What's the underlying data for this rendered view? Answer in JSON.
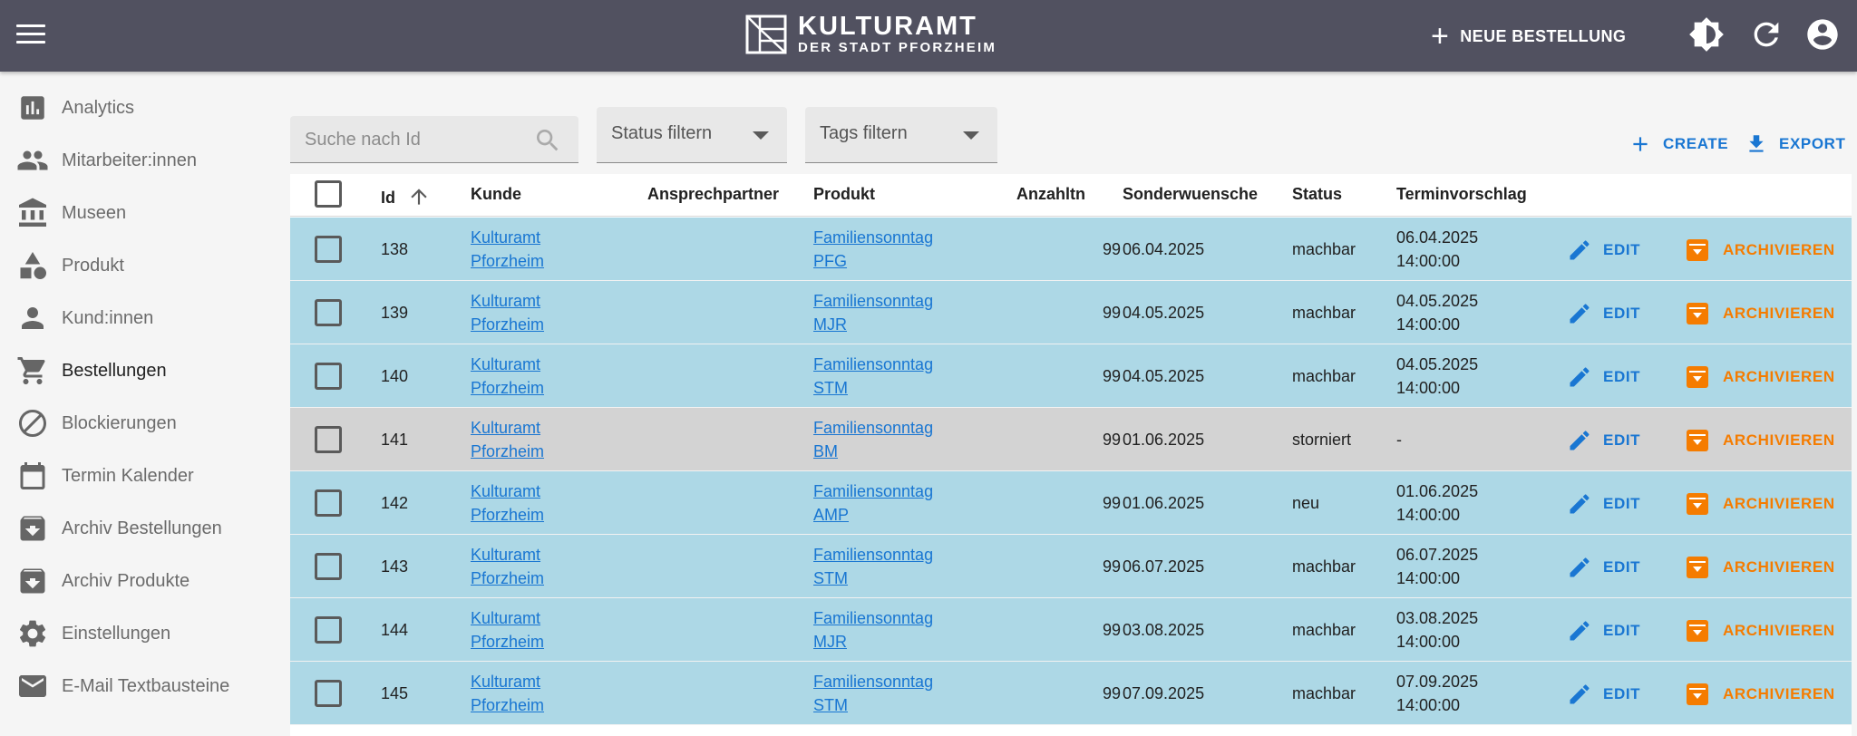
{
  "brand": {
    "name": "KULTURAMT",
    "subtitle": "DER STADT PFORZHEIM"
  },
  "appbar": {
    "new_order_label": "NEUE BESTELLUNG",
    "icons": [
      "menu-icon",
      "brightness-icon",
      "refresh-icon",
      "account-icon"
    ],
    "background": "#515160"
  },
  "sidebar": {
    "items": [
      {
        "label": "Analytics",
        "icon": "bar-chart-icon"
      },
      {
        "label": "Mitarbeiter:innen",
        "icon": "people-icon"
      },
      {
        "label": "Museen",
        "icon": "museum-icon"
      },
      {
        "label": "Produkt",
        "icon": "shapes-icon"
      },
      {
        "label": "Kund:innen",
        "icon": "person-icon"
      },
      {
        "label": "Bestellungen",
        "icon": "cart-icon",
        "active": true
      },
      {
        "label": "Blockierungen",
        "icon": "block-icon"
      },
      {
        "label": "Termin Kalender",
        "icon": "calendar-icon"
      },
      {
        "label": "Archiv Bestellungen",
        "icon": "archive-icon"
      },
      {
        "label": "Archiv Produkte",
        "icon": "archive-icon"
      },
      {
        "label": "Einstellungen",
        "icon": "gear-icon"
      },
      {
        "label": "E-Mail Textbausteine",
        "icon": "mail-icon"
      }
    ]
  },
  "filters": {
    "search_placeholder": "Suche nach Id",
    "status_label": "Status filtern",
    "tags_label": "Tags filtern"
  },
  "toolbar": {
    "create_label": "CREATE",
    "export_label": "EXPORT"
  },
  "table": {
    "columns": [
      "Id",
      "Kunde",
      "Ansprechpartner",
      "Produkt",
      "Anzahltn",
      "Sonderwuensche",
      "Status",
      "Terminvorschlag"
    ],
    "sort": {
      "column": "Id",
      "direction": "asc"
    },
    "edit_label": "EDIT",
    "archive_label": "ARCHIVIEREN",
    "rows": [
      {
        "id": "138",
        "kunde": [
          "Kulturamt",
          "Pforzheim"
        ],
        "ansprechpartner": "",
        "produkt": [
          "Familiensonntag",
          "PFG"
        ],
        "anzahl": "99",
        "sonder": "06.04.2025",
        "status": "machbar",
        "termin": [
          "06.04.2025",
          "14:00:00"
        ],
        "color": "#add8e6"
      },
      {
        "id": "139",
        "kunde": [
          "Kulturamt",
          "Pforzheim"
        ],
        "ansprechpartner": "",
        "produkt": [
          "Familiensonntag",
          "MJR"
        ],
        "anzahl": "99",
        "sonder": "04.05.2025",
        "status": "machbar",
        "termin": [
          "04.05.2025",
          "14:00:00"
        ],
        "color": "#add8e6"
      },
      {
        "id": "140",
        "kunde": [
          "Kulturamt",
          "Pforzheim"
        ],
        "ansprechpartner": "",
        "produkt": [
          "Familiensonntag",
          "STM"
        ],
        "anzahl": "99",
        "sonder": "04.05.2025",
        "status": "machbar",
        "termin": [
          "04.05.2025",
          "14:00:00"
        ],
        "color": "#add8e6"
      },
      {
        "id": "141",
        "kunde": [
          "Kulturamt",
          "Pforzheim"
        ],
        "ansprechpartner": "",
        "produkt": [
          "Familiensonntag",
          "BM"
        ],
        "anzahl": "99",
        "sonder": "01.06.2025",
        "status": "storniert",
        "termin": [
          "-"
        ],
        "color": "#d3d3d3"
      },
      {
        "id": "142",
        "kunde": [
          "Kulturamt",
          "Pforzheim"
        ],
        "ansprechpartner": "",
        "produkt": [
          "Familiensonntag",
          "AMP"
        ],
        "anzahl": "99",
        "sonder": "01.06.2025",
        "status": "neu",
        "termin": [
          "01.06.2025",
          "14:00:00"
        ],
        "color": "#add8e6"
      },
      {
        "id": "143",
        "kunde": [
          "Kulturamt",
          "Pforzheim"
        ],
        "ansprechpartner": "",
        "produkt": [
          "Familiensonntag",
          "STM"
        ],
        "anzahl": "99",
        "sonder": "06.07.2025",
        "status": "machbar",
        "termin": [
          "06.07.2025",
          "14:00:00"
        ],
        "color": "#add8e6"
      },
      {
        "id": "144",
        "kunde": [
          "Kulturamt",
          "Pforzheim"
        ],
        "ansprechpartner": "",
        "produkt": [
          "Familiensonntag",
          "MJR"
        ],
        "anzahl": "99",
        "sonder": "03.08.2025",
        "status": "machbar",
        "termin": [
          "03.08.2025",
          "14:00:00"
        ],
        "color": "#add8e6"
      },
      {
        "id": "145",
        "kunde": [
          "Kulturamt",
          "Pforzheim"
        ],
        "ansprechpartner": "",
        "produkt": [
          "Familiensonntag",
          "STM"
        ],
        "anzahl": "99",
        "sonder": "07.09.2025",
        "status": "machbar",
        "termin": [
          "07.09.2025",
          "14:00:00"
        ],
        "color": "#add8e6"
      }
    ]
  },
  "colors": {
    "accent": "#1976d2",
    "archive": "#f57c00",
    "row_active": "#add8e6",
    "row_cancelled": "#d3d3d3"
  }
}
